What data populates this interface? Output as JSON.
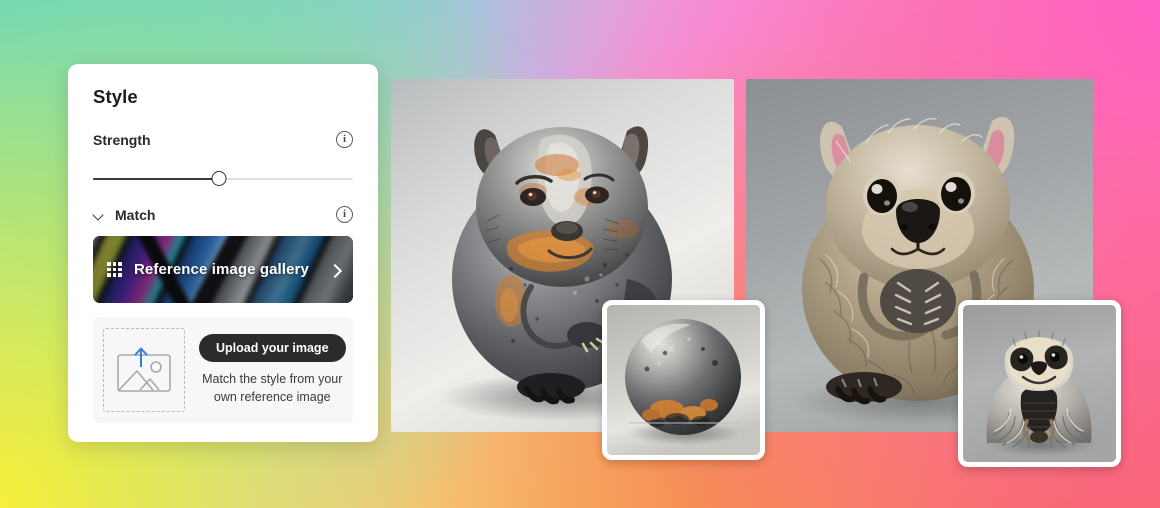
{
  "panel": {
    "title": "Style",
    "strength": {
      "label": "Strength",
      "info_icon": "info-icon",
      "slider_value_percent": 48.5
    },
    "match": {
      "label": "Match",
      "chevron_icon": "chevron-down-icon",
      "info_icon": "info-icon",
      "expanded": true
    },
    "gallery": {
      "grid_icon": "grid-icon",
      "label": "Reference image gallery",
      "chevron_icon": "chevron-right-icon"
    },
    "upload": {
      "dropzone_icon": "image-upload-icon",
      "button_label": "Upload your image",
      "caption": "Match the style from your own reference image"
    }
  },
  "canvas": {
    "results": [
      {
        "name": "metallic-rusted-wombat",
        "alt": "Metallic rusted wombat figurine on grey backdrop"
      },
      {
        "name": "furry-wombat",
        "alt": "Photoreal furry wombat sitting upright on grey backdrop"
      }
    ],
    "reference_thumbnails": [
      {
        "name": "metal-sphere",
        "alt": "Weathered metal sphere with orange rust patches"
      },
      {
        "name": "knitted-sloth",
        "alt": "Knitted grey sloth figurine"
      }
    ]
  },
  "colors": {
    "accent_dark": "#2b2b2b",
    "slider_fill": "#3b3b3b",
    "panel_bg": "#ffffff",
    "upload_bg": "#f7f7f7",
    "upload_arrow": "#2f7fe0"
  }
}
